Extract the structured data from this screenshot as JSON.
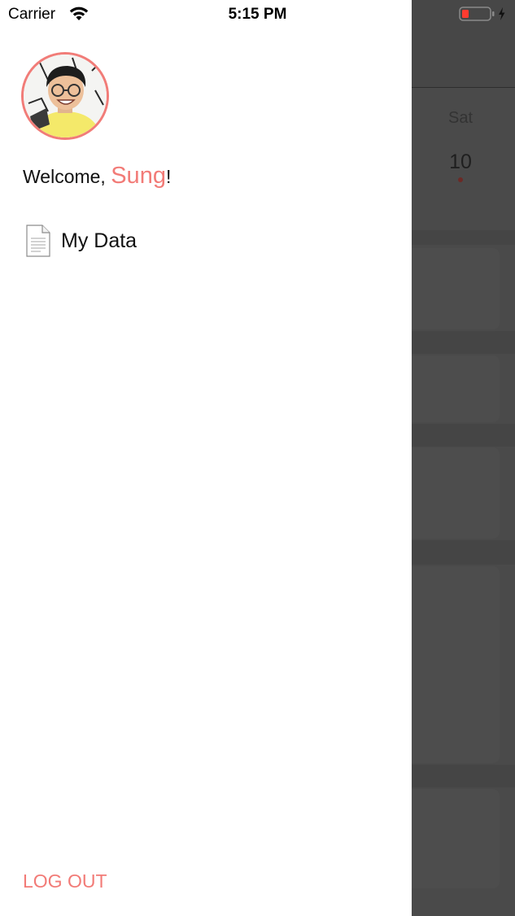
{
  "status_bar": {
    "carrier": "Carrier",
    "time": "5:15 PM",
    "wifi_icon": "wifi-icon",
    "battery_icon": "battery-low-charging-icon"
  },
  "drawer": {
    "avatar_icon": "user-avatar-photo",
    "welcome_prefix": "Welcome, ",
    "user_name": "Sung",
    "welcome_suffix": "!",
    "menu": [
      {
        "label": "My Data",
        "icon": "document-icon"
      }
    ],
    "logout_label": "LOG OUT"
  },
  "background_calendar": {
    "weekday": "Sat",
    "day": "10"
  },
  "colors": {
    "accent": "#f27b77",
    "drawer_bg": "#ffffff",
    "overlay_bg": "#4a4a4a",
    "battery_low": "#ff3b30"
  }
}
